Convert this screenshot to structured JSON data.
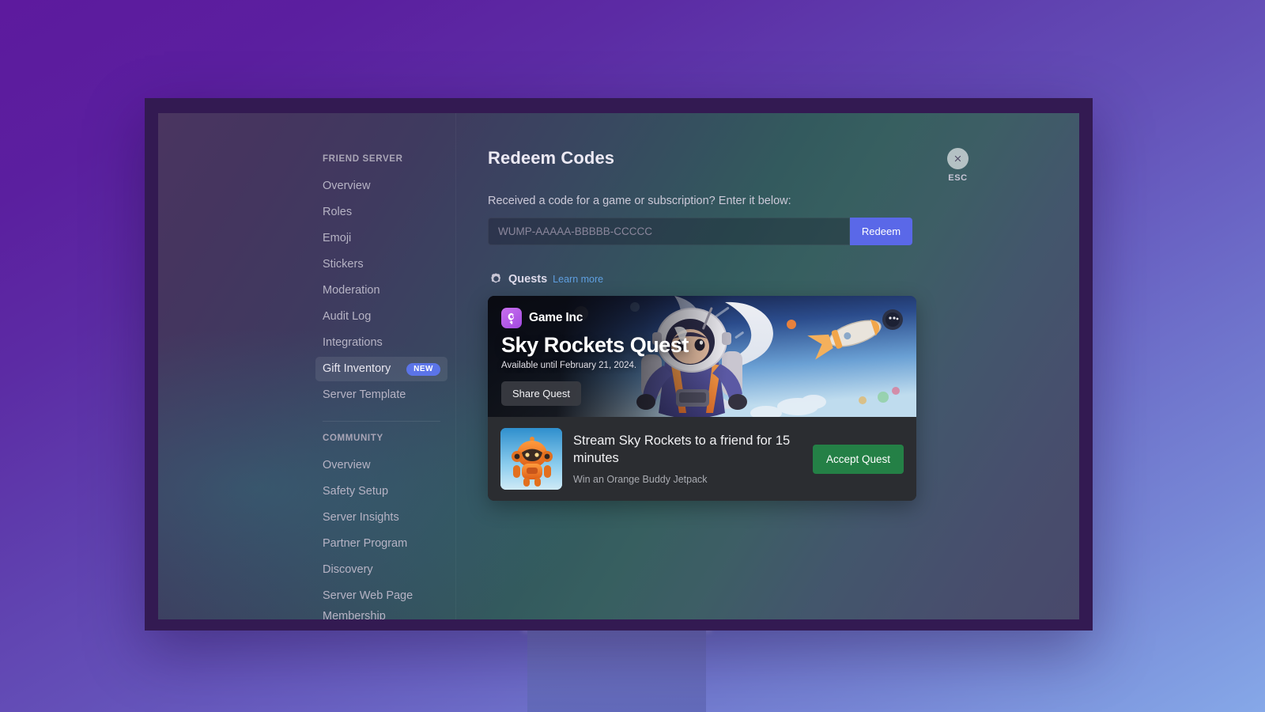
{
  "sidebar": {
    "sections": [
      {
        "heading": "FRIEND SERVER",
        "items": [
          {
            "label": "Overview",
            "badge": null,
            "active": false
          },
          {
            "label": "Roles",
            "badge": null,
            "active": false
          },
          {
            "label": "Emoji",
            "badge": null,
            "active": false
          },
          {
            "label": "Stickers",
            "badge": null,
            "active": false
          },
          {
            "label": "Moderation",
            "badge": null,
            "active": false
          },
          {
            "label": "Audit Log",
            "badge": null,
            "active": false
          },
          {
            "label": "Integrations",
            "badge": null,
            "active": false
          },
          {
            "label": "Gift Inventory",
            "badge": "NEW",
            "active": true
          },
          {
            "label": "Server Template",
            "badge": null,
            "active": false
          }
        ]
      },
      {
        "heading": "COMMUNITY",
        "items": [
          {
            "label": "Overview",
            "badge": null,
            "active": false
          },
          {
            "label": "Safety Setup",
            "badge": null,
            "active": false
          },
          {
            "label": "Server Insights",
            "badge": null,
            "active": false
          },
          {
            "label": "Partner Program",
            "badge": null,
            "active": false
          },
          {
            "label": "Discovery",
            "badge": null,
            "active": false
          },
          {
            "label": "Server Web Page",
            "badge": null,
            "active": false
          },
          {
            "label": "Membership Screening",
            "badge": null,
            "active": false
          }
        ]
      }
    ]
  },
  "main": {
    "title": "Redeem Codes",
    "redeem": {
      "subtitle": "Received a code for a game or subscription? Enter it below:",
      "input_value": "",
      "input_placeholder": "WUMP-AAAAA-BBBBB-CCCCC",
      "button_label": "Redeem"
    },
    "quests": {
      "section_label": "Quests",
      "learn_more_label": "Learn more",
      "icon": "quest-gear-icon",
      "card": {
        "brand_name": "Game Inc",
        "brand_logo_icon": "game-inc-logo-icon",
        "quest_title": "Sky Rockets Quest",
        "availability": "Available until February 21, 2024.",
        "share_label": "Share Quest",
        "task_title": "Stream Sky Rockets to a friend for 15 minutes",
        "task_reward": "Win an Orange Buddy Jetpack",
        "accept_label": "Accept Quest",
        "reward_thumb_icon": "orange-buddy-jetpack-icon"
      }
    }
  },
  "close": {
    "label": "ESC",
    "icon": "close-x-icon"
  },
  "colors": {
    "accent_blurple": "#5a68e8",
    "accept_green": "#248046",
    "badge_new": "#5b74e8",
    "learn_more_link": "#5f9fe0",
    "brand_logo": "#a24ae0",
    "card_bg": "#2b2d31"
  }
}
